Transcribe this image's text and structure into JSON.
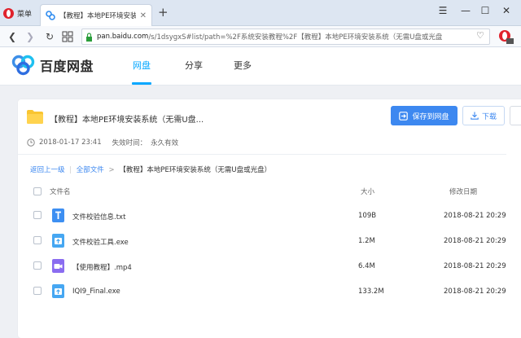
{
  "browser": {
    "menu_label": "菜单",
    "tab_title": "【教程】本地PE环境安装",
    "url_host": "pan.baidu.com",
    "url_rest": "/s/1dsygxS#list/path=%2F系统安装教程%2F【教程】本地PE环境安装系统（无需U盘或光盘"
  },
  "site": {
    "logo_text": "百度网盘",
    "nav": [
      "网盘",
      "分享",
      "更多"
    ],
    "accent_color": "#06a7ff"
  },
  "share": {
    "title": "【教程】本地PE环境安装系统（无需U盘...",
    "save_button": "保存到网盘",
    "download_button": "下载",
    "created": "2018-01-17 23:41",
    "expiry_label": "失效时间：",
    "expiry_value": "永久有效",
    "button_color": "#3d88f0"
  },
  "breadcrumb": {
    "back": "返回上一级",
    "all": "全部文件",
    "sep": ">",
    "current": "【教程】本地PE环境安装系统（无需U盘或光盘）"
  },
  "table": {
    "headers": {
      "name": "文件名",
      "size": "大小",
      "date": "修改日期"
    },
    "rows": [
      {
        "icon": "text-file-icon",
        "name": "文件校验信息.txt",
        "size": "109B",
        "date": "2018-08-21 20:29"
      },
      {
        "icon": "exe-file-icon",
        "name": "文件校验工具.exe",
        "size": "1.2M",
        "date": "2018-08-21 20:29"
      },
      {
        "icon": "video-file-icon",
        "name": "【使用教程】.mp4",
        "size": "6.4M",
        "date": "2018-08-21 20:29"
      },
      {
        "icon": "exe-file-icon",
        "name": "IQI9_Final.exe",
        "size": "133.2M",
        "date": "2018-08-21 20:29"
      }
    ]
  }
}
